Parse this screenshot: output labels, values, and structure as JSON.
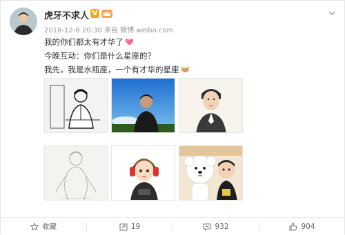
{
  "post": {
    "username": "虎牙不求人",
    "badge_v": "V",
    "timestamp": "2018-12-8 20:30",
    "source_prefix": "来自",
    "source_name": "微博 weibo.com",
    "lines": [
      "我的你们都太有才华了",
      "今晚互动：你们是什么星座的？",
      "我先，我是水瓶座，一个有才华的星座"
    ],
    "line_emojis": [
      "heart-icon",
      "",
      "cat-face-icon"
    ],
    "images": [
      {
        "name": "sketch-man-thumbnail"
      },
      {
        "name": "blue-sky-photo-thumbnail"
      },
      {
        "name": "watercolor-portrait-thumbnail"
      },
      {
        "name": "pencil-sketch-thumbnail"
      },
      {
        "name": "cartoon-headphones-thumbnail"
      },
      {
        "name": "cartoon-plush-dog-thumbnail"
      }
    ]
  },
  "actions": {
    "favorite_label": "收藏",
    "repost_count": "19",
    "comment_count": "932",
    "like_count": "904"
  },
  "colors": {
    "accent_orange": "#f5a623",
    "text_primary": "#333333",
    "text_muted": "#999999",
    "heart": "#f06a8c"
  }
}
